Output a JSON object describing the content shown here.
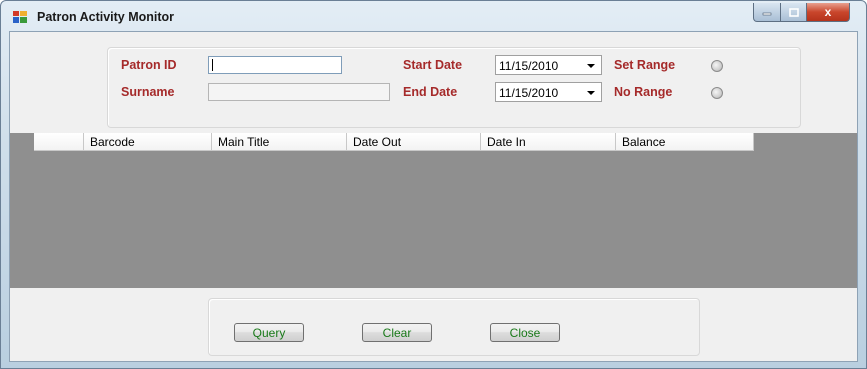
{
  "window": {
    "title": "Patron Activity Monitor",
    "close_glyph": "x"
  },
  "form": {
    "patron_id_label": "Patron ID",
    "patron_id_value": "",
    "surname_label": "Surname",
    "surname_value": "",
    "start_date_label": "Start Date",
    "start_date_value": "11/15/2010",
    "end_date_label": "End Date",
    "end_date_value": "11/15/2010",
    "set_range_label": "Set Range",
    "no_range_label": "No Range"
  },
  "grid": {
    "columns": [
      "Barcode",
      "Main Title",
      "Date Out",
      "Date In",
      "Balance"
    ]
  },
  "buttons": {
    "query": "Query",
    "clear": "Clear",
    "close": "Close"
  },
  "colors": {
    "label": "#a52a2a",
    "button_text": "#1a7a1a",
    "grid_background": "#8f8f8f"
  }
}
